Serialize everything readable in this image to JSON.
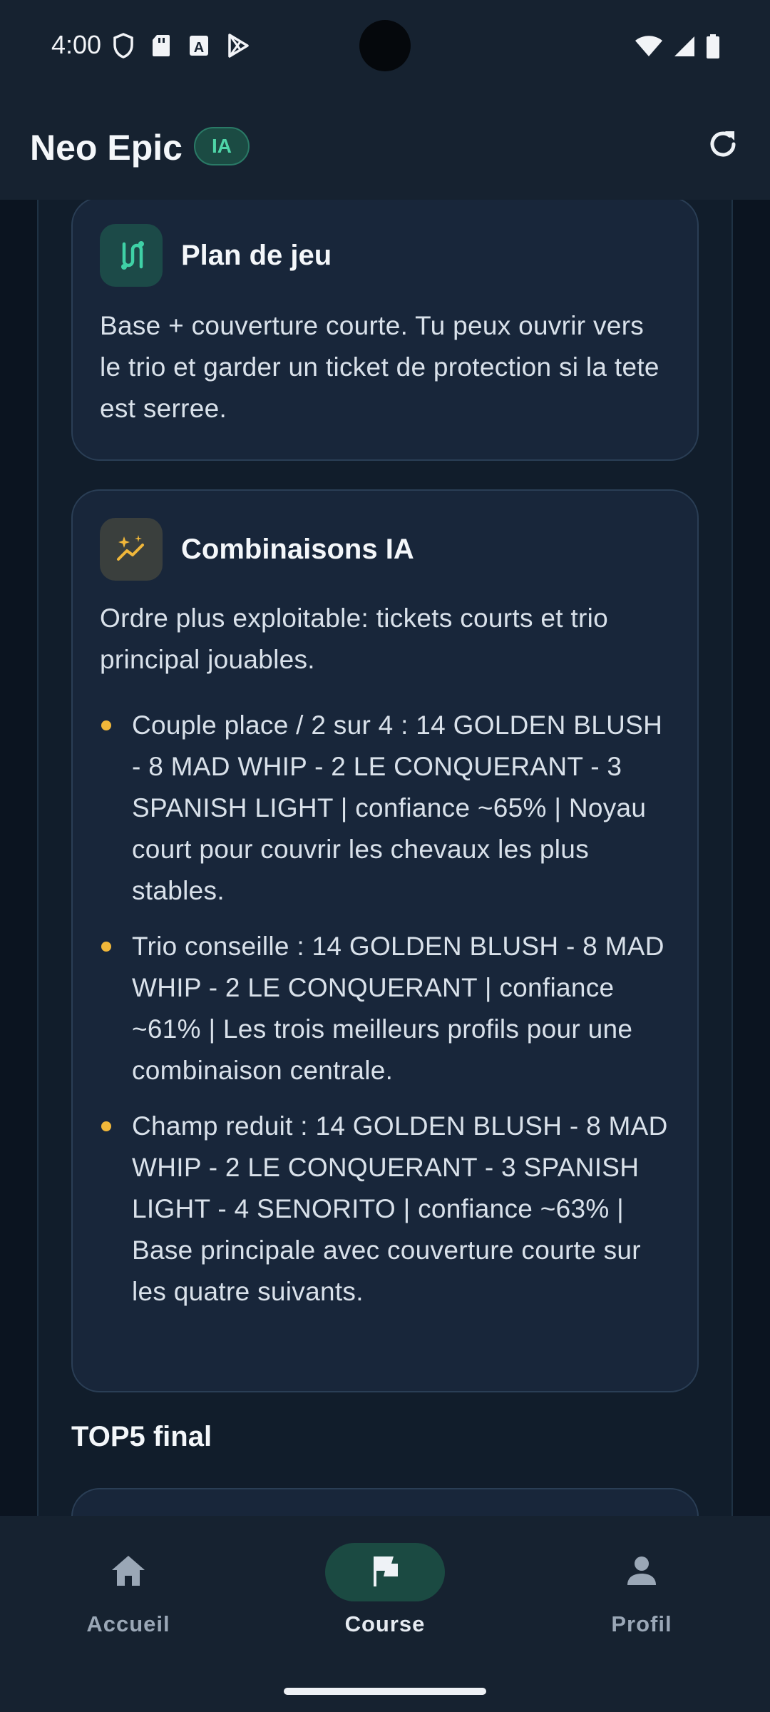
{
  "status_bar": {
    "time": "4:00"
  },
  "app_bar": {
    "title": "Neo Epic",
    "badge": "IA"
  },
  "cards": {
    "plan": {
      "title": "Plan de jeu",
      "text": "Base + couverture courte. Tu peux ouvrir vers le trio et garder un ticket de protection si la tete est serree."
    },
    "combinaisons": {
      "title": "Combinaisons IA",
      "intro": "Ordre plus exploitable: tickets courts et trio principal jouables.",
      "items": [
        "Couple place / 2 sur 4 : 14 GOLDEN BLUSH - 8 MAD WHIP - 2 LE CONQUERANT - 3 SPANISH LIGHT | confiance ~65% | Noyau court pour couvrir les chevaux les plus stables.",
        "Trio conseille : 14 GOLDEN BLUSH - 8 MAD WHIP - 2 LE CONQUERANT | confiance ~61% | Les trois meilleurs profils pour une combinaison centrale.",
        "Champ reduit : 14 GOLDEN BLUSH - 8 MAD WHIP - 2 LE CONQUERANT - 3 SPANISH LIGHT - 4 SENORITO | confiance ~63% | Base principale avec couverture courte sur les quatre suivants."
      ]
    }
  },
  "sections": {
    "top5_title": "TOP5 final"
  },
  "bottom_nav": {
    "items": [
      {
        "label": "Accueil",
        "icon": "home-icon"
      },
      {
        "label": "Course",
        "icon": "flag-icon",
        "active": true
      },
      {
        "label": "Profil",
        "icon": "person-icon"
      }
    ]
  },
  "colors": {
    "accent": "#4fd6a8",
    "bullet": "#f0b73a",
    "card_bg": "#18263a",
    "background": "#101b28"
  }
}
